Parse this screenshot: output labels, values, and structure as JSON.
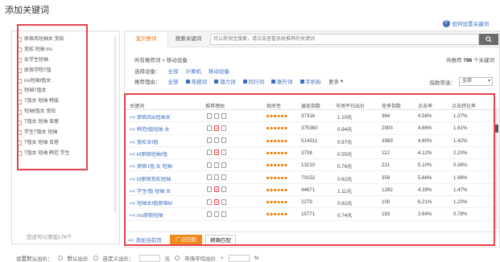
{
  "title": "添加关键词",
  "help_link": "如何设置关键词",
  "left": {
    "items": [
      "原宿风短袖女 宽松",
      "宽松 短袖 ins",
      "女学生短袖",
      "原宿学院T恤",
      "ins短袖t恤女",
      "短袖T恤女",
      "T恤女 短袖 韩版",
      "短袖t恤女 宽松",
      "T恤女 短袖 显瘦",
      "学生T恤女 短袖",
      "T恤女 短袖 百搭",
      "T恤女 短袖 韩范 学生"
    ],
    "footer": "您还可以添加176个"
  },
  "tabs": [
    "宝贝推词",
    "搜索关键词"
  ],
  "search": {
    "placeholder": "可以将淘宝搜索，请点击查看系统推荐的关键词"
  },
  "crumb": "所有推荐词 > 移动设备",
  "total": {
    "prefix": "共推荐",
    "count": "798",
    "suffix": "个关键词"
  },
  "filters": {
    "device": {
      "label": "选择设备：",
      "options": [
        "全部",
        "计算机",
        "移动设备"
      ]
    },
    "reason": {
      "label": "推荐理由：",
      "options": [
        "全部",
        "热搜词",
        "潜力词",
        "同行词",
        "飙升词",
        "手机标"
      ],
      "more": "更多"
    },
    "sort": {
      "label": "指数筛选：",
      "value": "全部"
    }
  },
  "table": {
    "headers": [
      "关键词",
      "推荐理由",
      "相关性",
      "展现指数",
      "市场平均出价",
      "竞争指数",
      "点击率",
      "点击转化率"
    ],
    "rows": [
      {
        "kw": "<< 原宿风ib短袖女",
        "bid": "1.10元",
        "imp": "37316",
        "comp": "364",
        "ctr": "4.56%",
        "cvr": "1.37%",
        "red": false
      },
      {
        "kw": "<< 韩范t恤短袖 女",
        "bid": "0.94元",
        "imp": "375360",
        "comp": "2993",
        "ctr": "4.66%",
        "cvr": "1.61%",
        "red": true
      },
      {
        "kw": "<< 宽松女t恤",
        "bid": "0.97元",
        "imp": "514311",
        "comp": "3989",
        "ctr": "4.80%",
        "cvr": "1.42%",
        "red": false
      },
      {
        "kw": "<< bf原宿短袖t恤",
        "bid": "0.55元",
        "imp": "3708",
        "comp": "112",
        "ctr": "4.12%",
        "cvr": "2.20%",
        "red": true
      },
      {
        "kw": "<< 原宿 t恤 女 短袖",
        "bid": "0.76元",
        "imp": "13210",
        "comp": "221",
        "ctr": "5.10%",
        "cvr": "0.36%",
        "red": false
      },
      {
        "kw": "<< bf原宿宽松短袖",
        "bid": "0.62元",
        "imp": "70152",
        "comp": "359",
        "ctr": "5.66%",
        "cvr": "1.96%",
        "red": false
      },
      {
        "kw": "<< 学生t恤 短袖 女",
        "bid": "1.11元",
        "imp": "44671",
        "comp": "1282",
        "ctr": "4.39%",
        "cvr": "1.47%",
        "red": true
      },
      {
        "kw": "<< 短袖女t恤原宿bf",
        "bid": "0.82元",
        "imp": "2279",
        "comp": "100",
        "ctr": "6.21%",
        "cvr": "1.20%",
        "red": true
      },
      {
        "kw": "<< ins原宿短袖",
        "bid": "0.74元",
        "imp": "15771",
        "comp": "183",
        "ctr": "2.64%",
        "cvr": "0.78%",
        "red": false
      }
    ]
  },
  "bottom": {
    "add_page": "<< 添加当前页",
    "wide": "广泛匹配",
    "exact": "精确匹配"
  },
  "settings": {
    "label": "设置默认出价：",
    "default_bid": "默认出价",
    "custom_bid": "自定义出价：",
    "unit": "元",
    "market_bid": "市场平均出价",
    "percent": "%"
  },
  "colors": {
    "accent": "#f08a1c",
    "link": "#3d6fc4",
    "highlight": "#e5414c"
  }
}
